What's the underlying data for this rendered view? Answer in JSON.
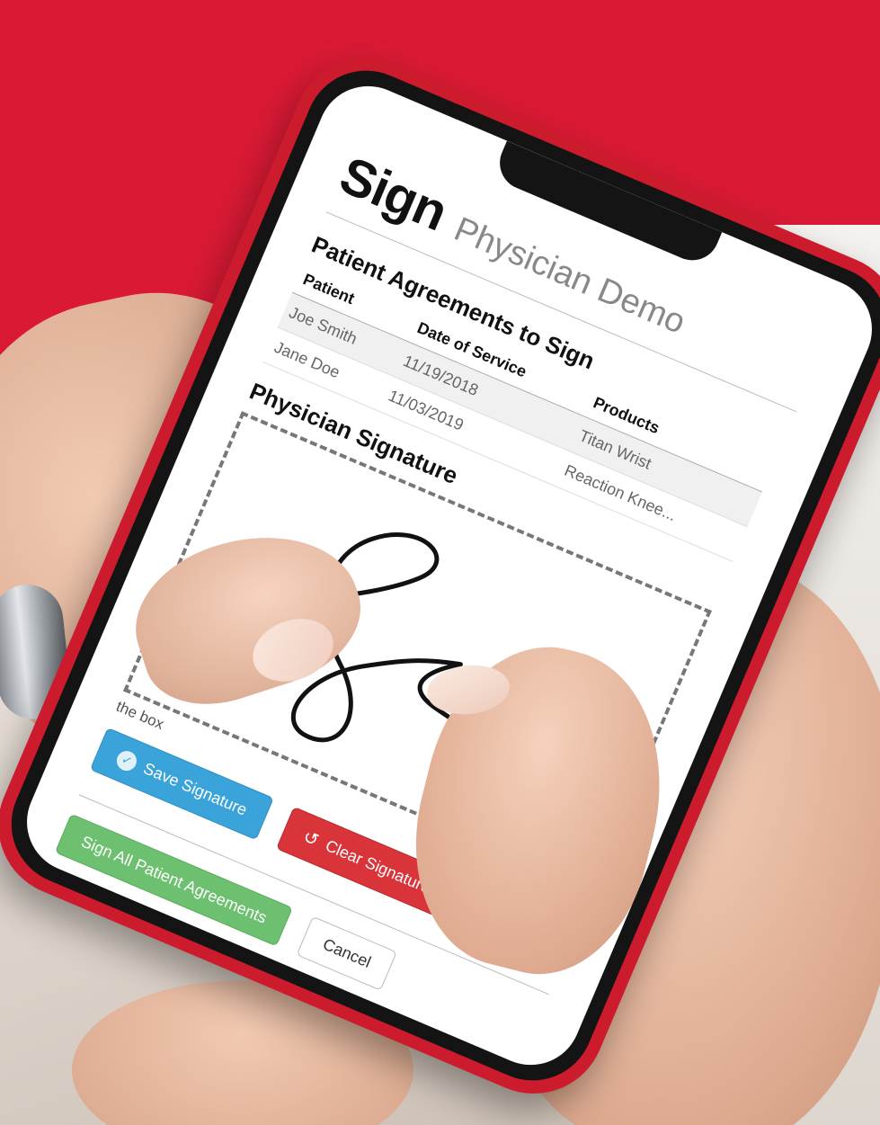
{
  "app": {
    "title": "Sign",
    "subtitle": "Physician Demo"
  },
  "agreements": {
    "section_title": "Patient Agreements to Sign",
    "columns": [
      "Patient",
      "Date of Service",
      "Products"
    ],
    "rows": [
      [
        "Joe Smith",
        "11/19/2018",
        "Titan Wrist"
      ],
      [
        "Jane Doe",
        "11/03/2019",
        "Reaction Knee..."
      ]
    ]
  },
  "signature": {
    "section_title": "Physician Signature",
    "hint": "the box"
  },
  "buttons": {
    "save_signature": "Save Signature",
    "clear_signature": "Clear Signature",
    "sign_all": "Sign All Patient Agreements",
    "cancel": "Cancel"
  },
  "icons": {
    "save": "check-circle-icon",
    "clear": "rotate-left-icon"
  },
  "colors": {
    "background_red": "#da1a35",
    "phone_red": "#cc1b2c",
    "save_blue": "#3aa3d9",
    "clear_red": "#d9343a",
    "sign_green": "#6cc06f"
  }
}
